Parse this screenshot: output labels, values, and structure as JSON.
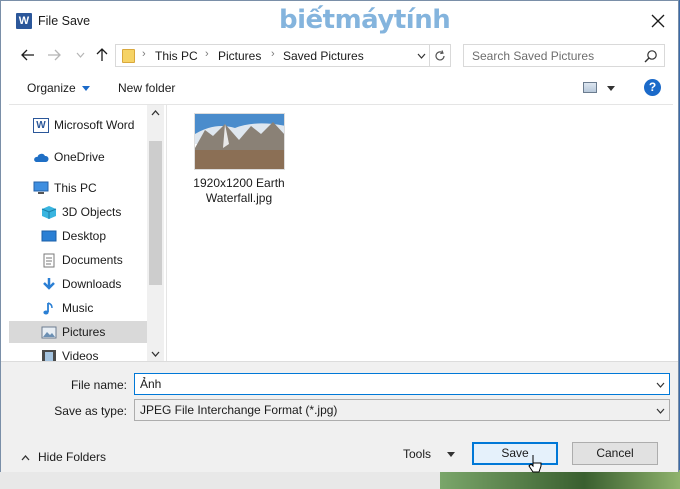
{
  "window": {
    "title": "File Save",
    "watermark": "biếtmáytính",
    "app_icon_letter": "W"
  },
  "nav": {
    "breadcrumbs": [
      "This PC",
      "Pictures",
      "Saved Pictures"
    ],
    "search_placeholder": "Search Saved Pictures"
  },
  "toolbar": {
    "organize_label": "Organize",
    "new_folder_label": "New folder",
    "help_label": "?"
  },
  "sidebar": {
    "items": [
      {
        "label": "Microsoft Word",
        "icon": "word-icon"
      },
      {
        "label": "OneDrive",
        "icon": "cloud-icon"
      },
      {
        "label": "This PC",
        "icon": "computer-icon"
      },
      {
        "label": "3D Objects",
        "icon": "cube-icon"
      },
      {
        "label": "Desktop",
        "icon": "desktop-icon"
      },
      {
        "label": "Documents",
        "icon": "document-icon"
      },
      {
        "label": "Downloads",
        "icon": "download-icon"
      },
      {
        "label": "Music",
        "icon": "music-icon"
      },
      {
        "label": "Pictures",
        "icon": "pictures-icon",
        "selected": true
      },
      {
        "label": "Videos",
        "icon": "film-icon"
      }
    ]
  },
  "files": [
    {
      "name_line1": "1920x1200 Earth",
      "name_line2": "Waterfall.jpg"
    }
  ],
  "footer": {
    "file_name_label": "File name:",
    "file_name_value": "Ảnh",
    "save_type_label": "Save as type:",
    "save_type_value": "JPEG File Interchange Format (*.jpg)",
    "hide_folders_label": "Hide Folders",
    "tools_label": "Tools",
    "save_label": "Save",
    "cancel_label": "Cancel"
  },
  "colors": {
    "accent": "#0078d7",
    "help_blue": "#1b6ac9",
    "selected_bg": "#d9d9d9"
  }
}
